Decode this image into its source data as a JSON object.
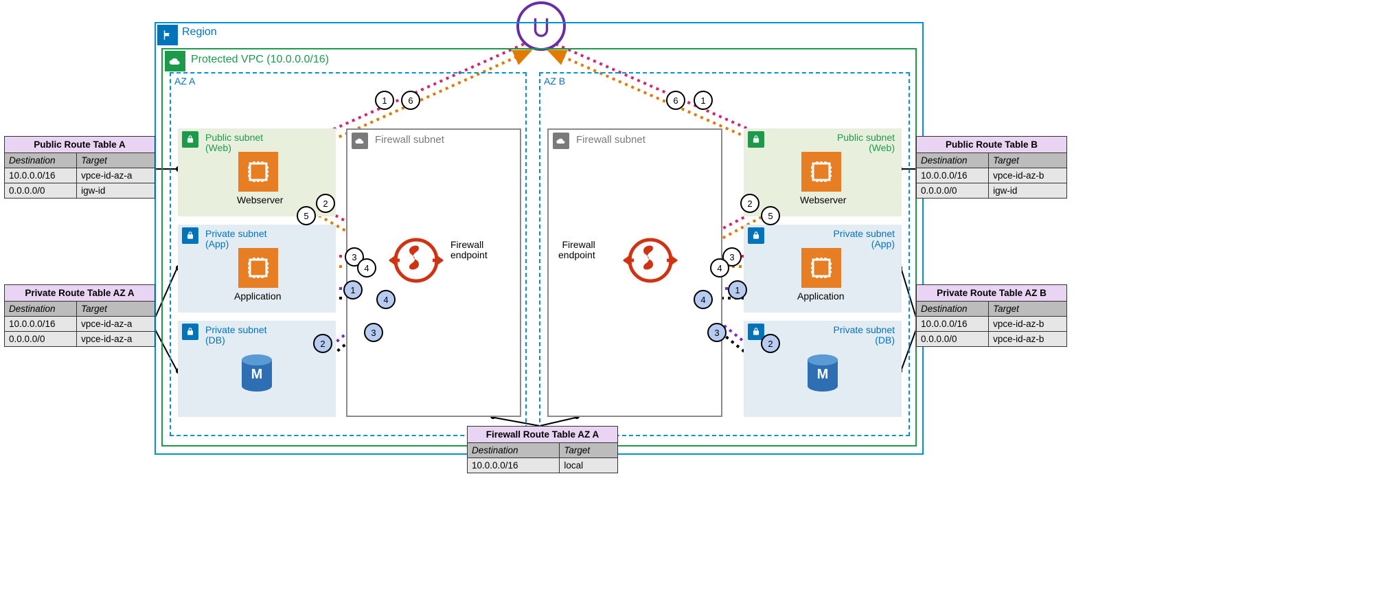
{
  "igw": {
    "name": "internet-gateway-icon"
  },
  "region": {
    "label": "Region"
  },
  "vpc": {
    "label": "Protected VPC (10.0.0.0/16)"
  },
  "az": {
    "a": "AZ A",
    "b": "AZ B"
  },
  "subnet": {
    "public_title_l1": "Public subnet",
    "public_title_l2": "(Web)",
    "app_title_l1": "Private subnet",
    "app_title_l2": "(App)",
    "db_title_l1": "Private subnet",
    "db_title_l2": "(DB)",
    "firewall_title": "Firewall subnet"
  },
  "resources": {
    "webserver": "Webserver",
    "application": "Application",
    "firewall_endpoint_l1": "Firewall",
    "firewall_endpoint_l2": "endpoint"
  },
  "route_tables": {
    "pub_a": {
      "title": "Public Route Table A",
      "col1": "Destination",
      "col2": "Target",
      "rows": [
        {
          "dest": "10.0.0.0/16",
          "target": "vpce-id-az-a"
        },
        {
          "dest": "0.0.0.0/0",
          "target": "igw-id"
        }
      ]
    },
    "priv_a": {
      "title": "Private Route Table AZ A",
      "col1": "Destination",
      "col2": "Target",
      "rows": [
        {
          "dest": "10.0.0.0/16",
          "target": "vpce-id-az-a"
        },
        {
          "dest": "0.0.0.0/0",
          "target": "vpce-id-az-a"
        }
      ]
    },
    "pub_b": {
      "title": "Public Route Table B",
      "col1": "Destination",
      "col2": "Target",
      "rows": [
        {
          "dest": "10.0.0.0/16",
          "target": "vpce-id-az-b"
        },
        {
          "dest": "0.0.0.0/0",
          "target": "igw-id"
        }
      ]
    },
    "priv_b": {
      "title": "Private Route Table AZ B",
      "col1": "Destination",
      "col2": "Target",
      "rows": [
        {
          "dest": "10.0.0.0/16",
          "target": "vpce-id-az-b"
        },
        {
          "dest": "0.0.0.0/0",
          "target": "vpce-id-az-b"
        }
      ]
    },
    "fw_a": {
      "title": "Firewall Route Table AZ A",
      "col1": "Destination",
      "col2": "Target",
      "rows": [
        {
          "dest": "10.0.0.0/16",
          "target": "local"
        }
      ]
    }
  },
  "steps": {
    "white": [
      "1",
      "2",
      "3",
      "4",
      "5",
      "6"
    ],
    "blue": [
      "1",
      "2",
      "3",
      "4"
    ]
  },
  "colors": {
    "region_blue": "#0073bb",
    "vpc_green": "#1b9b4a",
    "orange": "#e77e23",
    "pink": "#d6246f",
    "dark_orange": "#e07b00",
    "purple": "#7a26d9",
    "black": "#000000",
    "firewall_red": "#d13212"
  }
}
